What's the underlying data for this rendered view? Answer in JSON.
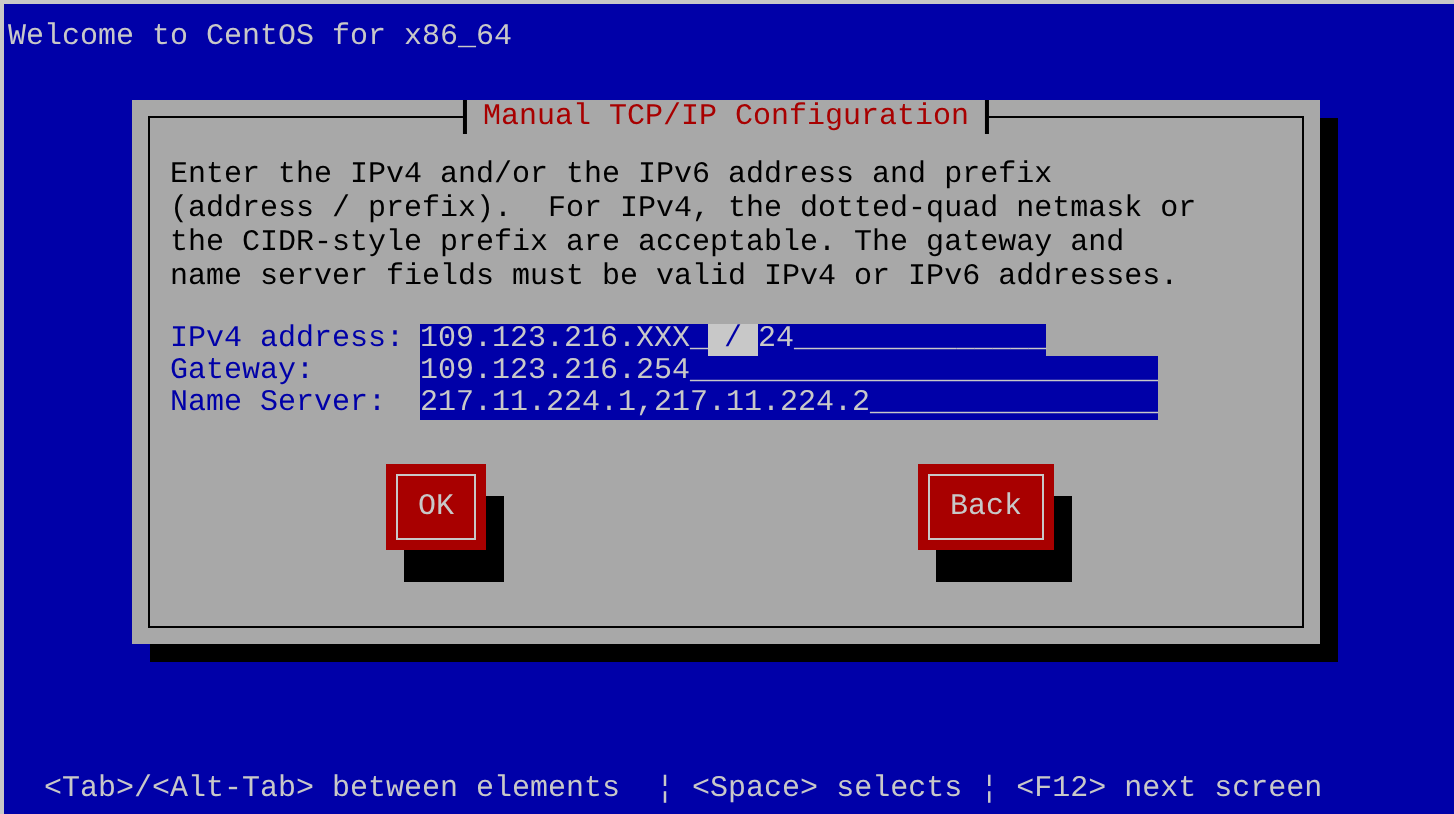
{
  "screen": {
    "title": "Welcome to CentOS for x86_64"
  },
  "dialog": {
    "title": "Manual TCP/IP Configuration",
    "message": "Enter the IPv4 and/or the IPv6 address and prefix (address / prefix).  For IPv4, the dotted-quad netmask or the CIDR-style prefix are acceptable. The gateway and name server fields must be valid IPv4 or IPv6 addresses.",
    "fields": [
      {
        "label": "IPv4 address:",
        "value": "109.123.216.XXX_",
        "separator": "/",
        "prefix": "24______________"
      },
      {
        "label": "Gateway:",
        "value": "109.123.216.254__________________________"
      },
      {
        "label": "Name Server:",
        "value": "217.11.224.1,217.11.224.2________________"
      }
    ],
    "buttons": [
      {
        "label": "OK"
      },
      {
        "label": "Back"
      }
    ]
  },
  "status_bar": "<Tab>/<Alt-Tab> between elements  ¦ <Space> selects ¦ <F12> next screen"
}
